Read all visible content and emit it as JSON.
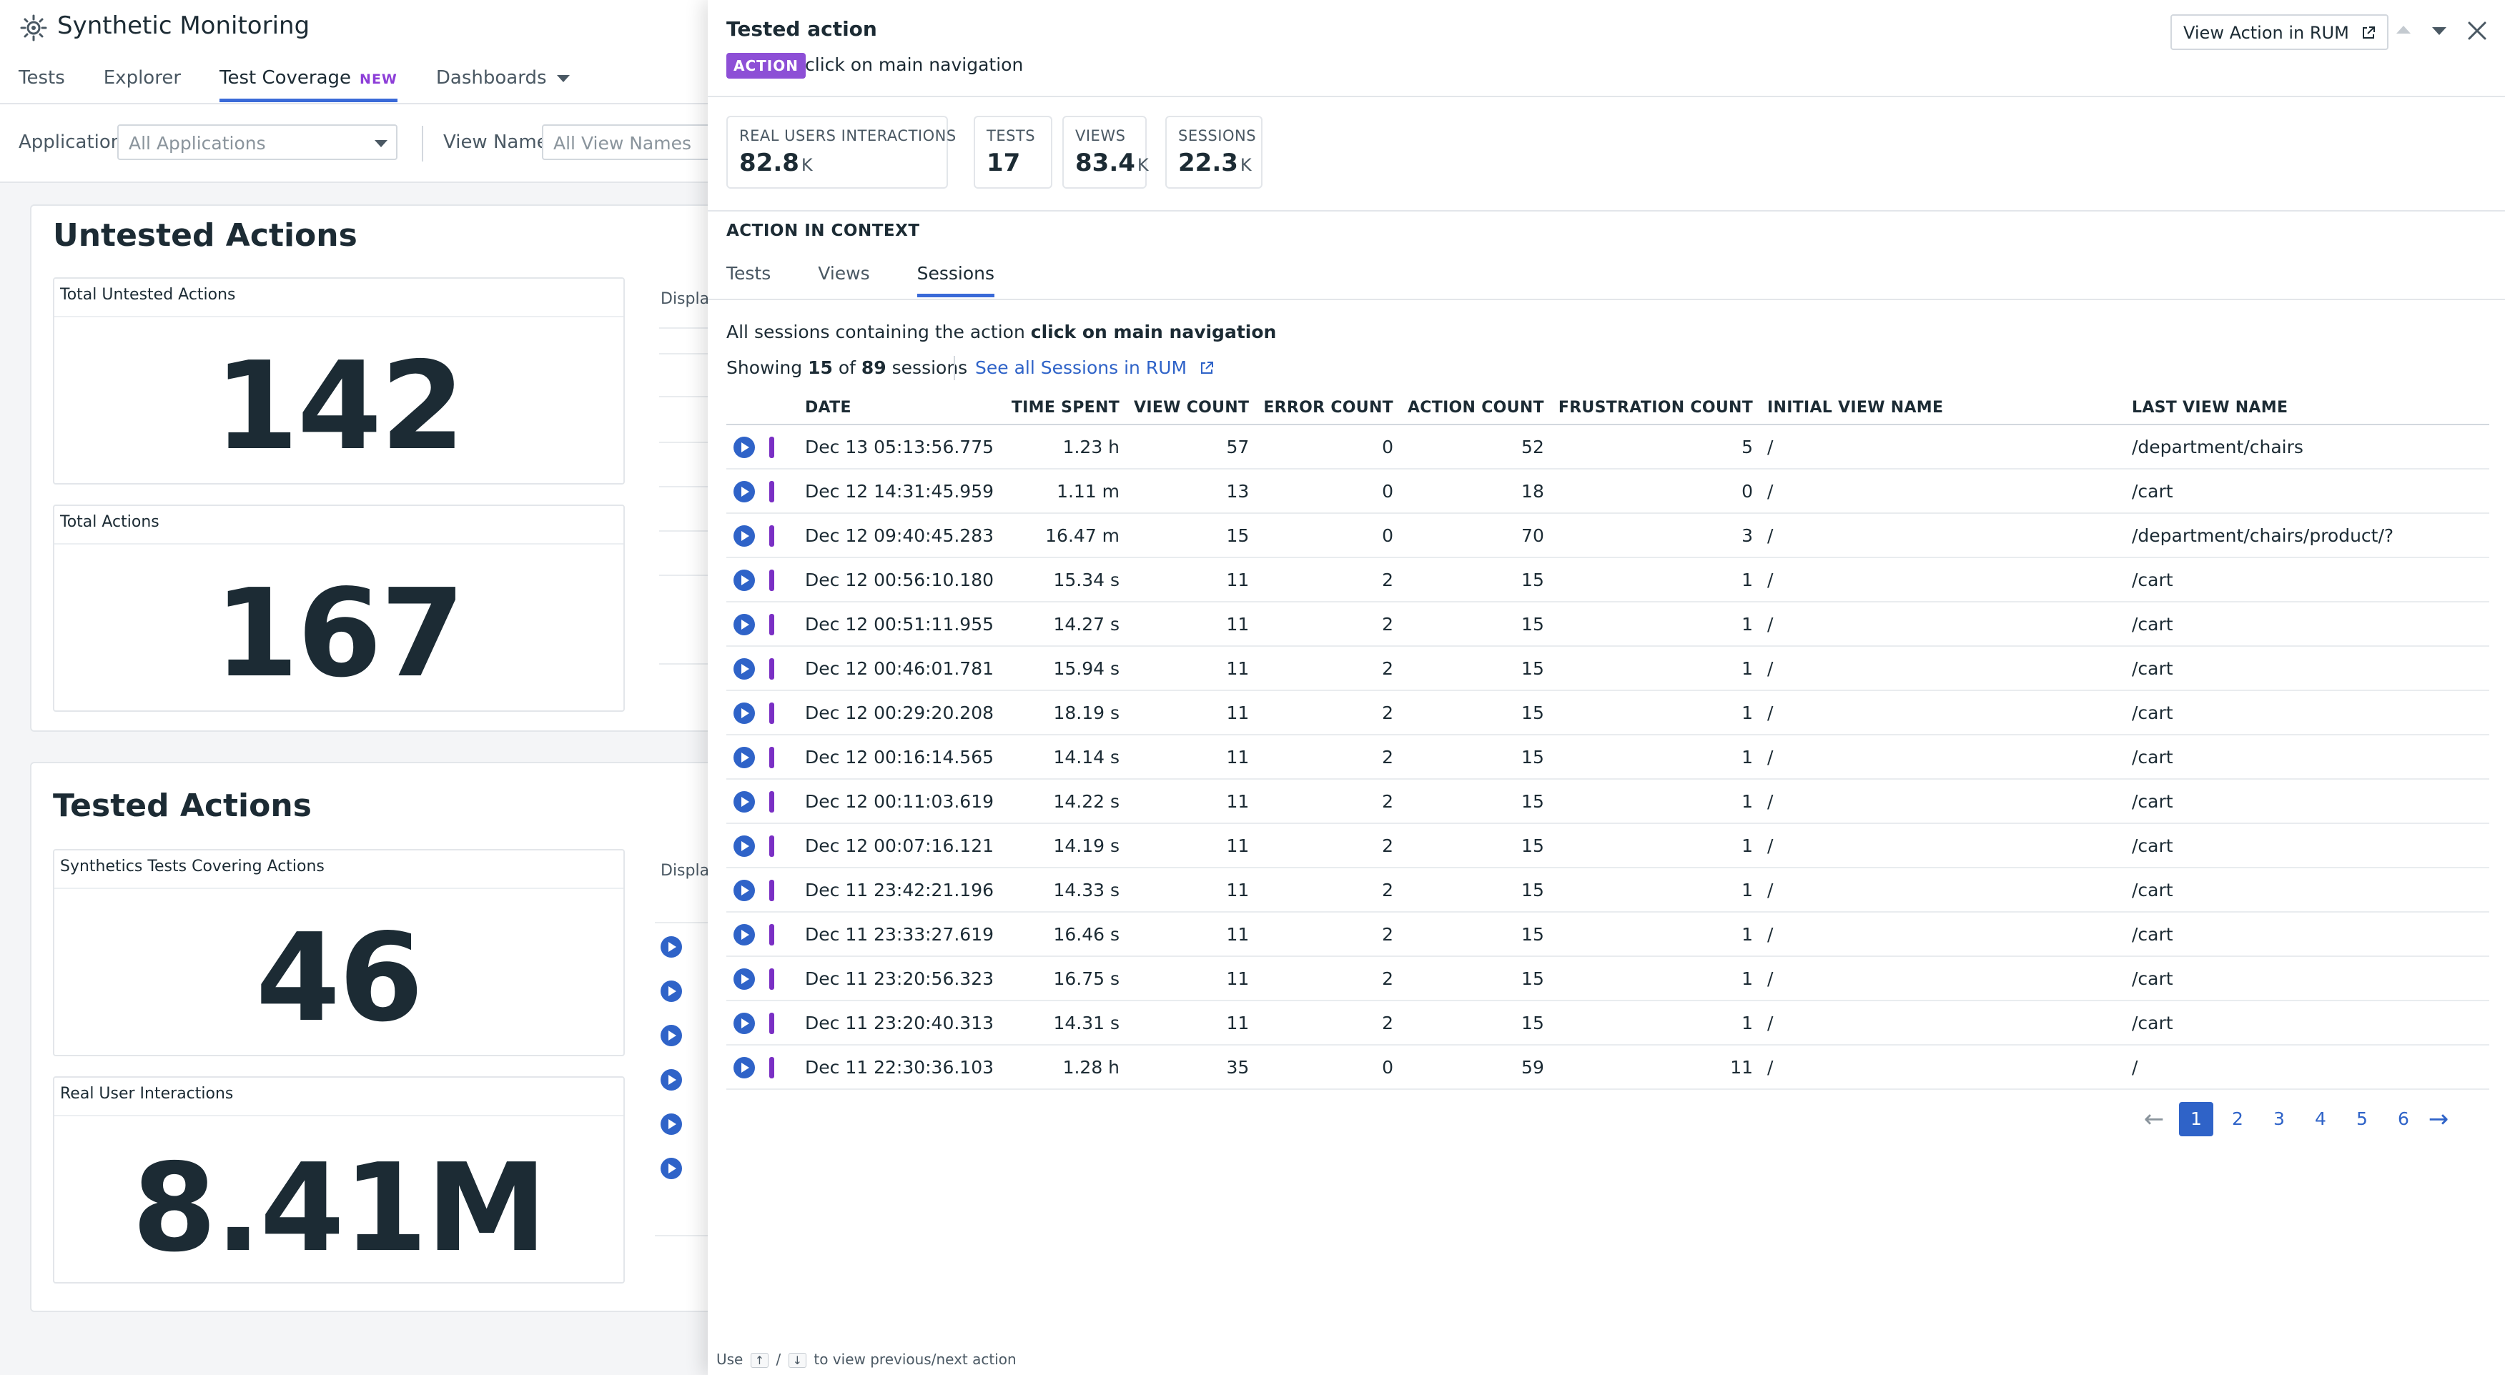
{
  "app": {
    "title": "Synthetic Monitoring",
    "nav": {
      "tabs": [
        {
          "label": "Tests"
        },
        {
          "label": "Explorer"
        },
        {
          "label": "Test Coverage",
          "badge": "NEW"
        },
        {
          "label": "Dashboards"
        }
      ]
    },
    "filters": {
      "application_label": "Application",
      "application_value": "All Applications",
      "view_name_label": "View Name",
      "view_name_placeholder": "All View Names"
    },
    "untested": {
      "title": "Untested Actions",
      "display_label": "Displa",
      "total_untested_label": "Total Untested Actions",
      "total_untested_value": "142",
      "total_actions_label": "Total Actions",
      "total_actions_value": "167"
    },
    "tested": {
      "title": "Tested Actions",
      "display_label": "Displa",
      "tests_covering_label": "Synthetics Tests Covering Actions",
      "tests_covering_value": "46",
      "real_user_label": "Real User Interactions",
      "real_user_value": "8.41M"
    }
  },
  "panel": {
    "title": "Tested action",
    "action_badge": "ACTION",
    "action_name": "click on main navigation",
    "view_rum_button": "View Action in RUM",
    "stats": [
      {
        "label": "REAL USERS INTERACTIONS",
        "value": "82.8",
        "unit": "K"
      },
      {
        "label": "TESTS",
        "value": "17",
        "unit": ""
      },
      {
        "label": "VIEWS",
        "value": "83.4",
        "unit": "K"
      },
      {
        "label": "SESSIONS",
        "value": "22.3",
        "unit": "K"
      }
    ],
    "context_title": "ACTION IN CONTEXT",
    "context_tabs": [
      {
        "label": "Tests"
      },
      {
        "label": "Views"
      },
      {
        "label": "Sessions",
        "active": true
      }
    ],
    "description_prefix": "All sessions containing the action",
    "description_action": "click on main navigation",
    "showing_prefix": "Showing",
    "showing_count": "15",
    "showing_of": "of",
    "showing_total": "89",
    "showing_suffix": "sessions",
    "see_all_link": "See all Sessions in RUM",
    "table": {
      "columns": [
        "DATE",
        "TIME SPENT",
        "VIEW COUNT",
        "ERROR COUNT",
        "ACTION COUNT",
        "FRUSTRATION COUNT",
        "INITIAL VIEW NAME",
        "LAST VIEW NAME"
      ],
      "rows": [
        [
          "Dec 13 05:13:56.775",
          "1.23 h",
          "57",
          "0",
          "52",
          "5",
          "/",
          "/department/chairs"
        ],
        [
          "Dec 12 14:31:45.959",
          "1.11 m",
          "13",
          "0",
          "18",
          "0",
          "/",
          "/cart"
        ],
        [
          "Dec 12 09:40:45.283",
          "16.47 m",
          "15",
          "0",
          "70",
          "3",
          "/",
          "/department/chairs/product/?"
        ],
        [
          "Dec 12 00:56:10.180",
          "15.34 s",
          "11",
          "2",
          "15",
          "1",
          "/",
          "/cart"
        ],
        [
          "Dec 12 00:51:11.955",
          "14.27 s",
          "11",
          "2",
          "15",
          "1",
          "/",
          "/cart"
        ],
        [
          "Dec 12 00:46:01.781",
          "15.94 s",
          "11",
          "2",
          "15",
          "1",
          "/",
          "/cart"
        ],
        [
          "Dec 12 00:29:20.208",
          "18.19 s",
          "11",
          "2",
          "15",
          "1",
          "/",
          "/cart"
        ],
        [
          "Dec 12 00:16:14.565",
          "14.14 s",
          "11",
          "2",
          "15",
          "1",
          "/",
          "/cart"
        ],
        [
          "Dec 12 00:11:03.619",
          "14.22 s",
          "11",
          "2",
          "15",
          "1",
          "/",
          "/cart"
        ],
        [
          "Dec 12 00:07:16.121",
          "14.19 s",
          "11",
          "2",
          "15",
          "1",
          "/",
          "/cart"
        ],
        [
          "Dec 11 23:42:21.196",
          "14.33 s",
          "11",
          "2",
          "15",
          "1",
          "/",
          "/cart"
        ],
        [
          "Dec 11 23:33:27.619",
          "16.46 s",
          "11",
          "2",
          "15",
          "1",
          "/",
          "/cart"
        ],
        [
          "Dec 11 23:20:56.323",
          "16.75 s",
          "11",
          "2",
          "15",
          "1",
          "/",
          "/cart"
        ],
        [
          "Dec 11 23:20:40.313",
          "14.31 s",
          "11",
          "2",
          "15",
          "1",
          "/",
          "/cart"
        ],
        [
          "Dec 11 22:30:36.103",
          "1.28 h",
          "35",
          "0",
          "59",
          "11",
          "/",
          "/"
        ]
      ]
    },
    "pagination": {
      "pages": [
        "1",
        "2",
        "3",
        "4",
        "5",
        "6"
      ],
      "current": "1",
      "prev": "←",
      "next": "→"
    },
    "footer": {
      "prefix": "Use",
      "key_up": "↑",
      "slash": "/",
      "key_down": "↓",
      "suffix": "to view previous/next action"
    }
  },
  "colors": {
    "accent": "#2f63c8",
    "action_badge": "#8d4fd6",
    "session_bar": "#7a2fc4",
    "new_badge": "#8d3ed8"
  },
  "icons": [
    "synthetics-logo-icon",
    "caret-down-icon",
    "external-link-icon",
    "arrow-up-icon",
    "arrow-down-icon",
    "close-icon",
    "play-icon"
  ]
}
